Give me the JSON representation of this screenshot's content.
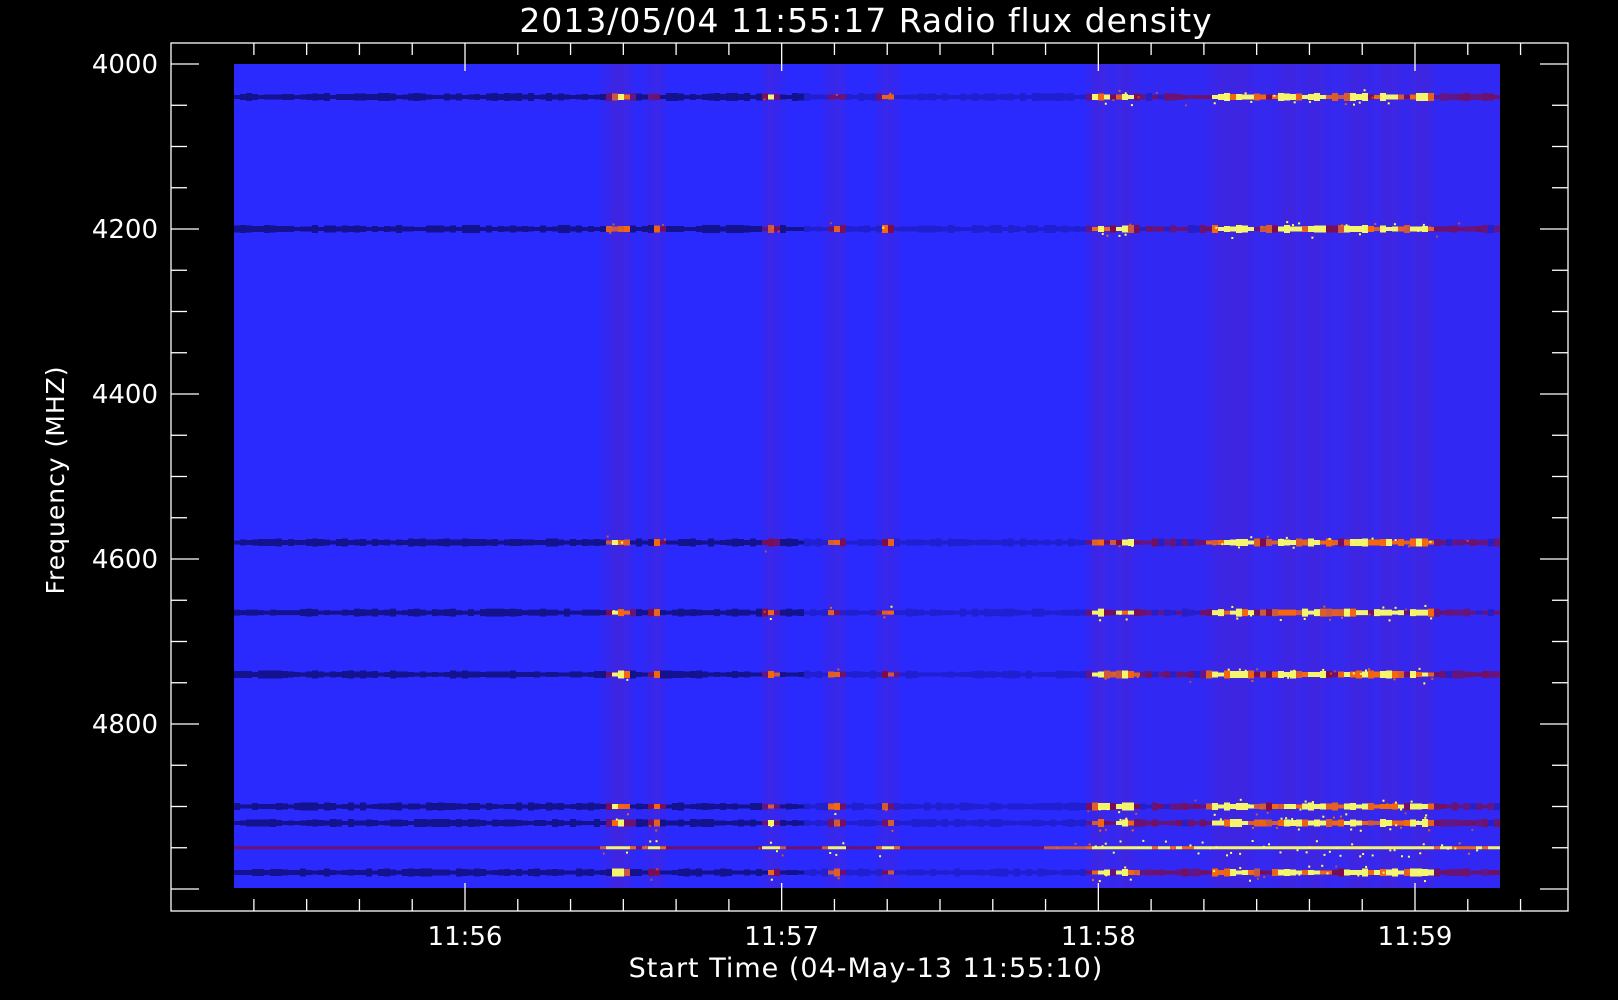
{
  "chart_data": {
    "type": "heatmap",
    "title": "2013/05/04 11:55:17 Radio flux density",
    "xlabel": "Start Time (04-May-13 11:55:10)",
    "ylabel": "Frequency (MHZ)",
    "x_ticks": [
      "11:56",
      "11:57",
      "11:58",
      "11:59"
    ],
    "x_tick_values_seconds_after_11_55": [
      60,
      120,
      180,
      240
    ],
    "x_range_seconds_after_11_55": [
      17,
      257
    ],
    "y_ticks": [
      4000,
      4200,
      4400,
      4600,
      4800
    ],
    "y_range": [
      4000,
      5000
    ],
    "y_reversed": true,
    "colormap": [
      "#0000ff",
      "#000033",
      "#a00000",
      "#ff6a00",
      "#ffff66"
    ],
    "background_color": "#2a2aff",
    "bright_frequency_bands_mhz": [
      4040,
      4200,
      4580,
      4665,
      4740,
      4900,
      4920,
      4950,
      4980
    ],
    "active_time_columns_seconds_after_11_55": [
      89,
      91,
      97,
      119,
      131,
      141,
      181,
      186,
      204,
      208,
      217,
      222,
      230,
      236,
      242
    ]
  }
}
